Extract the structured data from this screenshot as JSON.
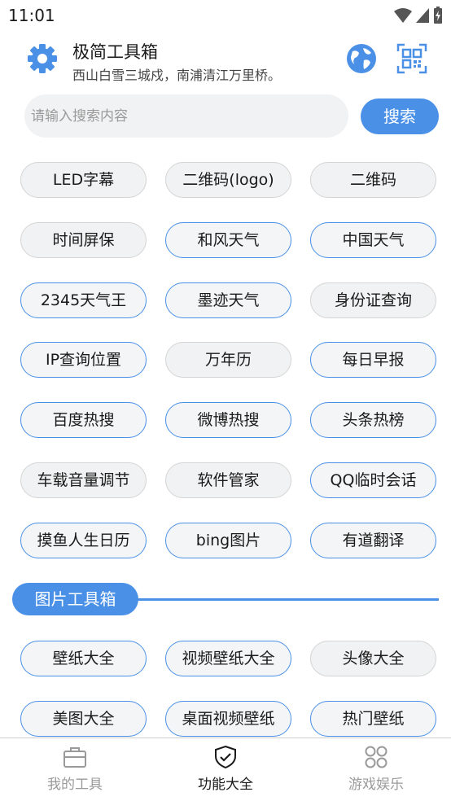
{
  "status_bar": {
    "time": "11:01"
  },
  "header": {
    "title": "极简工具箱",
    "subtitle": "西山白雪三城戍，南浦清江万里桥。"
  },
  "search": {
    "placeholder": "请输入搜索内容",
    "button_label": "搜索"
  },
  "tools": [
    {
      "label": "LED字幕",
      "style": "gray"
    },
    {
      "label": "二维码(logo)",
      "style": "gray"
    },
    {
      "label": "二维码",
      "style": "gray"
    },
    {
      "label": "时间屏保",
      "style": "gray"
    },
    {
      "label": "和风天气",
      "style": "blue"
    },
    {
      "label": "中国天气",
      "style": "blue"
    },
    {
      "label": "2345天气王",
      "style": "blue"
    },
    {
      "label": "墨迹天气",
      "style": "blue"
    },
    {
      "label": "身份证查询",
      "style": "gray"
    },
    {
      "label": "IP查询位置",
      "style": "blue"
    },
    {
      "label": "万年历",
      "style": "gray"
    },
    {
      "label": "每日早报",
      "style": "blue"
    },
    {
      "label": "百度热搜",
      "style": "blue"
    },
    {
      "label": "微博热搜",
      "style": "blue"
    },
    {
      "label": "头条热榜",
      "style": "blue"
    },
    {
      "label": "车载音量调节",
      "style": "gray"
    },
    {
      "label": "软件管家",
      "style": "gray"
    },
    {
      "label": "QQ临时会话",
      "style": "blue"
    },
    {
      "label": "摸鱼人生日历",
      "style": "blue"
    },
    {
      "label": "bing图片",
      "style": "blue"
    },
    {
      "label": "有道翻译",
      "style": "blue"
    }
  ],
  "image_section": {
    "title": "图片工具箱",
    "items": [
      {
        "label": "壁纸大全",
        "style": "blue"
      },
      {
        "label": "视频壁纸大全",
        "style": "blue"
      },
      {
        "label": "头像大全",
        "style": "gray"
      },
      {
        "label": "美图大全",
        "style": "blue"
      },
      {
        "label": "桌面视频壁纸",
        "style": "blue"
      },
      {
        "label": "热门壁纸",
        "style": "blue"
      }
    ]
  },
  "bottom_nav": [
    {
      "label": "我的工具",
      "icon": "toolbox-icon",
      "active": false
    },
    {
      "label": "功能大全",
      "icon": "shield-check-icon",
      "active": true
    },
    {
      "label": "游戏娱乐",
      "icon": "grid-icon",
      "active": false
    }
  ],
  "colors": {
    "accent": "#4a90e6",
    "chip_gray": "#f1f2f3"
  }
}
